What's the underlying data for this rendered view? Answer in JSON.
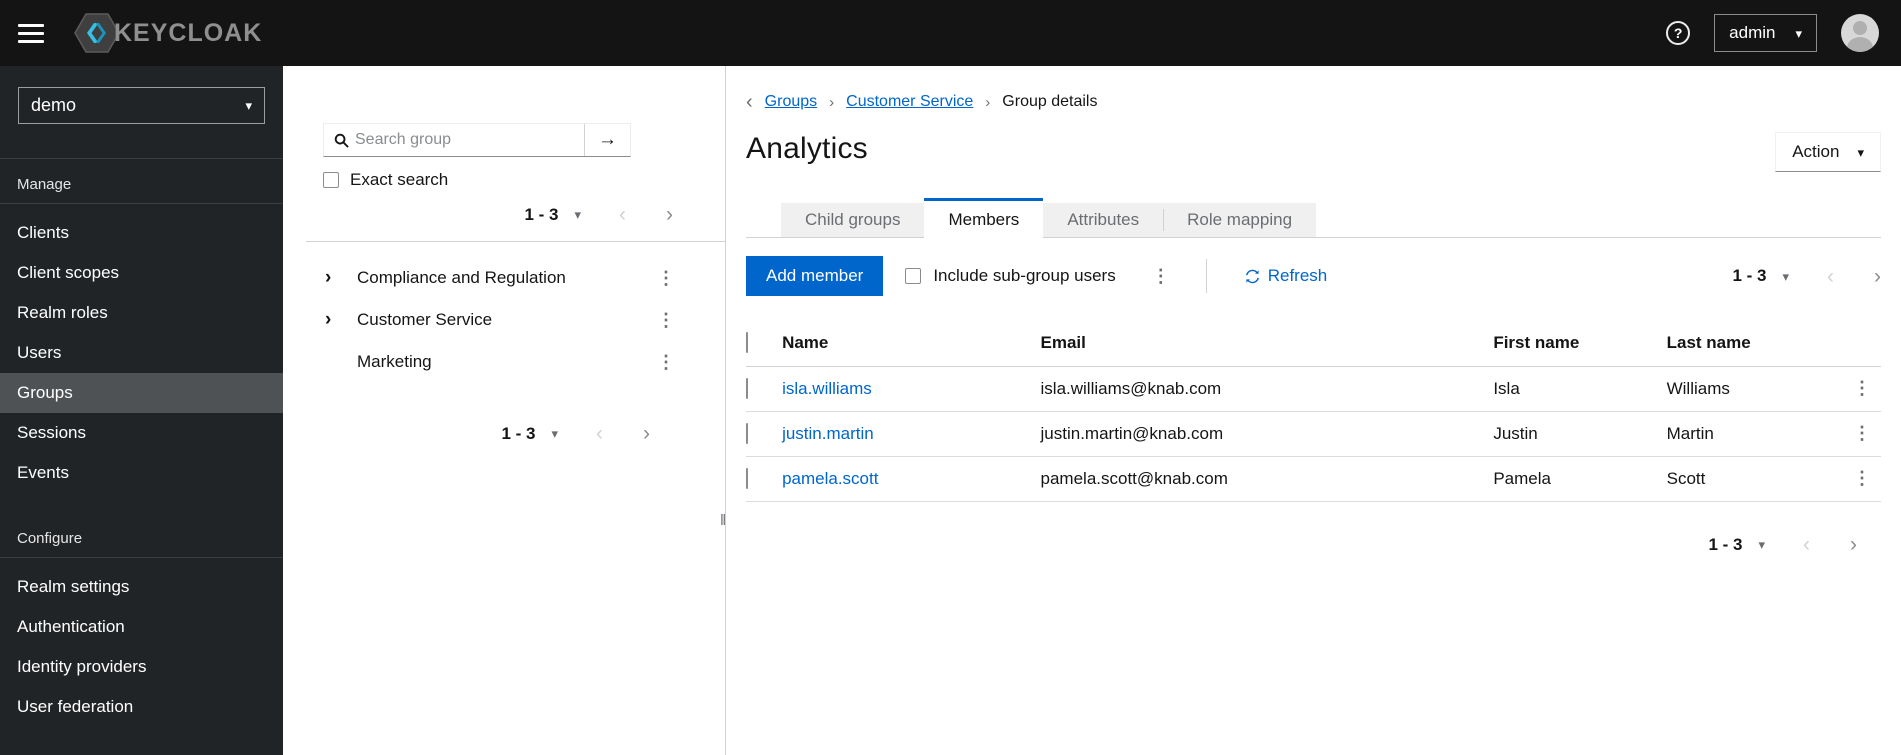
{
  "masthead": {
    "brand_text": "KEYCLOAK",
    "username": "admin"
  },
  "sidebar": {
    "realm": "demo",
    "sections": [
      {
        "label": "Manage",
        "items": [
          {
            "label": "Clients",
            "active": false
          },
          {
            "label": "Client scopes",
            "active": false
          },
          {
            "label": "Realm roles",
            "active": false
          },
          {
            "label": "Users",
            "active": false
          },
          {
            "label": "Groups",
            "active": true
          },
          {
            "label": "Sessions",
            "active": false
          },
          {
            "label": "Events",
            "active": false
          }
        ]
      },
      {
        "label": "Configure",
        "items": [
          {
            "label": "Realm settings",
            "active": false
          },
          {
            "label": "Authentication",
            "active": false
          },
          {
            "label": "Identity providers",
            "active": false
          },
          {
            "label": "User federation",
            "active": false
          }
        ]
      }
    ]
  },
  "groups_panel": {
    "search_placeholder": "Search group",
    "exact_search_label": "Exact search",
    "pagination_top": {
      "range": "1 - 3"
    },
    "pagination_bottom": {
      "range": "1 - 3"
    },
    "tree": [
      {
        "label": "Compliance and Regulation",
        "expandable": true
      },
      {
        "label": "Customer Service",
        "expandable": true
      },
      {
        "label": "Marketing",
        "expandable": false
      }
    ]
  },
  "main": {
    "breadcrumb": {
      "items": [
        "Groups",
        "Customer Service",
        "Group details"
      ]
    },
    "title": "Analytics",
    "action_label": "Action",
    "tabs": [
      {
        "label": "Child groups",
        "active": false
      },
      {
        "label": "Members",
        "active": true
      },
      {
        "label": "Attributes",
        "active": false
      },
      {
        "label": "Role mapping",
        "active": false
      }
    ],
    "toolbar": {
      "add_member_label": "Add member",
      "include_subgroup_label": "Include sub-group users",
      "refresh_label": "Refresh",
      "pagination": {
        "range": "1 - 3"
      }
    },
    "table": {
      "columns": [
        "Name",
        "Email",
        "First name",
        "Last name"
      ],
      "rows": [
        {
          "name": "isla.williams",
          "email": "isla.williams@knab.com",
          "first": "Isla",
          "last": "Williams"
        },
        {
          "name": "justin.martin",
          "email": "justin.martin@knab.com",
          "first": "Justin",
          "last": "Martin"
        },
        {
          "name": "pamela.scott",
          "email": "pamela.scott@knab.com",
          "first": "Pamela",
          "last": "Scott"
        }
      ]
    },
    "pagination_bottom": {
      "range": "1 - 3"
    }
  },
  "icons": {
    "help": "?",
    "caret_down": "▾",
    "angle_left": "‹",
    "angle_right": "›",
    "kebab": "⋮",
    "back_arrow": "‹",
    "breadcrumb_separator": "›",
    "submit_arrow": "→",
    "tree_expand": "›",
    "drag_handle": "‖"
  },
  "colors": {
    "accent_blue": "#0066cc",
    "masthead_bg": "#141414",
    "sidebar_bg": "#212427",
    "sidebar_active_bg": "#4f5255",
    "tab_inactive_bg": "#f0f0f0",
    "border_gray": "#d2d2d2",
    "text_muted": "#6a6e73"
  }
}
